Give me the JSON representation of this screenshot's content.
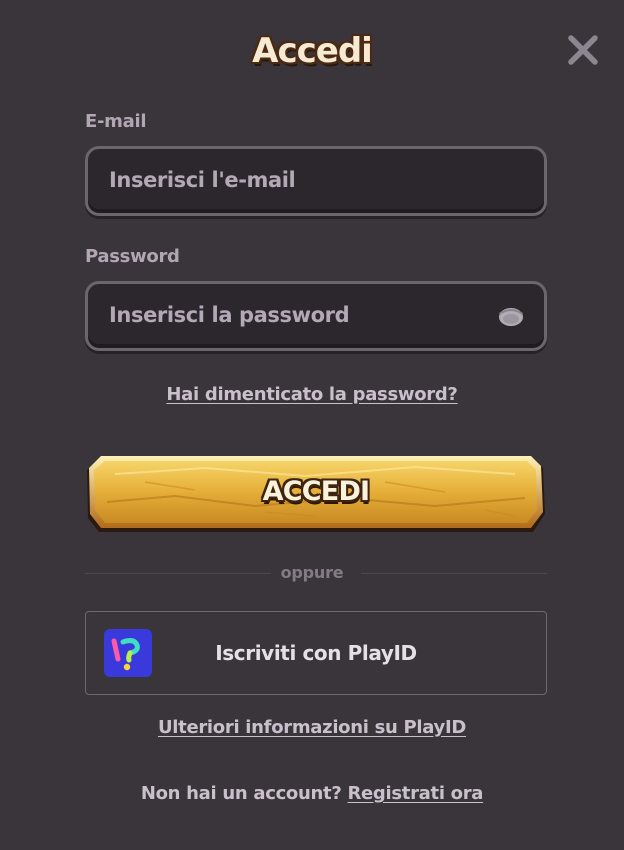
{
  "dialog": {
    "title": "Accedi",
    "close_icon": "close-icon"
  },
  "email": {
    "label": "E-mail",
    "placeholder": "Inserisci l'e-mail",
    "value": ""
  },
  "password": {
    "label": "Password",
    "placeholder": "Inserisci la password",
    "value": "",
    "toggle_icon": "eye-icon"
  },
  "forgot_link": "Hai dimenticato la password?",
  "submit_label": "ACCEDI",
  "divider_text": "oppure",
  "playid": {
    "button_label": "Iscriviti con PlayID",
    "logo_icon": "playid-logo-icon",
    "more_info_link": "Ulteriori informazioni su PlayID"
  },
  "signup": {
    "prompt": "Non hai un account?",
    "link": "Registrati ora"
  },
  "colors": {
    "background": "#39353a",
    "input_bg": "#2c272d",
    "label": "#b2a6b4",
    "gold": "#e8b43e",
    "playid_logo_bg": "#3a3adc"
  }
}
